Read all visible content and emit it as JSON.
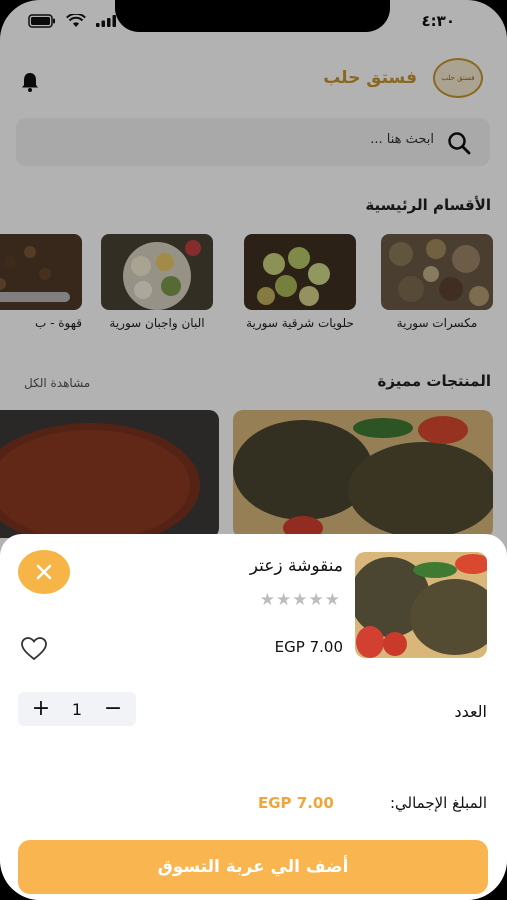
{
  "status_bar": {
    "time": "٤:٣٠"
  },
  "header": {
    "brand_name": "فستق حلب",
    "logo_text": "فستق حلب"
  },
  "search": {
    "placeholder": "ابحث هنا ..."
  },
  "categories_section": {
    "title": "الأقسام الرئيسية",
    "items": [
      {
        "label": "مكسرات سورية"
      },
      {
        "label": "حلويات شرقية سورية"
      },
      {
        "label": "البان واجبان سورية"
      },
      {
        "label": "قهوة - ب"
      }
    ]
  },
  "featured_section": {
    "title": "المنتجات مميزة",
    "see_all": "مشاهدة الكل"
  },
  "product_sheet": {
    "name": "منقوشة زعتر",
    "stars": "★★★★★",
    "rating": 0,
    "price": "EGP 7.00",
    "quantity_label": "العدد",
    "quantity": "1",
    "minus": "−",
    "plus": "+",
    "total_label": "المبلغ الإجمالي:",
    "total_value": "EGP 7.00",
    "add_to_cart": "أضف الي عربة التسوق"
  },
  "colors": {
    "accent": "#f8b550",
    "brand": "#c8962e",
    "total": "#f0a63a"
  }
}
